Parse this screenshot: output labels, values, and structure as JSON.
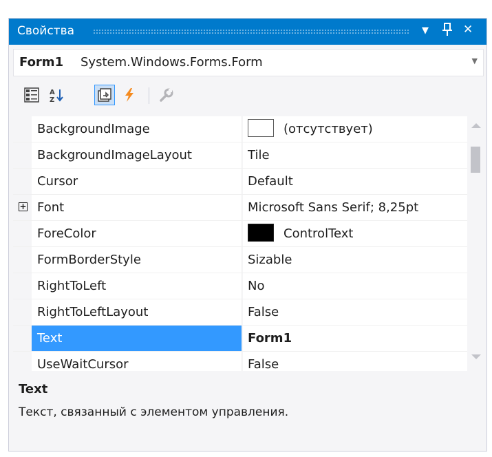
{
  "window": {
    "title": "Свойства",
    "controls": {
      "dropdown": "▼",
      "pin": "ᵖ",
      "close": "✕"
    }
  },
  "object_selector": {
    "name": "Form1",
    "type": "System.Windows.Forms.Form"
  },
  "toolbar": {
    "buttons": [
      {
        "icon": "categorized-icon",
        "active": false
      },
      {
        "icon": "alphabetical-icon",
        "active": false
      },
      {
        "icon": "properties-icon",
        "active": true
      },
      {
        "icon": "events-lightning-icon",
        "active": false
      },
      {
        "icon": "property-pages-wrench-icon",
        "active": false
      }
    ]
  },
  "properties": [
    {
      "name": "BackgroundImage",
      "value": "(отсутствует)",
      "swatch": "#ffffff"
    },
    {
      "name": "BackgroundImageLayout",
      "value": "Tile"
    },
    {
      "name": "Cursor",
      "value": "Default"
    },
    {
      "name": "Font",
      "value": "Microsoft Sans Serif; 8,25pt",
      "expander": "+"
    },
    {
      "name": "ForeColor",
      "value": "ControlText",
      "swatch": "#000000"
    },
    {
      "name": "FormBorderStyle",
      "value": "Sizable"
    },
    {
      "name": "RightToLeft",
      "value": "No"
    },
    {
      "name": "RightToLeftLayout",
      "value": "False"
    },
    {
      "name": "Text",
      "value": "Form1",
      "selected": true
    },
    {
      "name": "UseWaitCursor",
      "value": "False"
    }
  ],
  "description": {
    "title": "Text",
    "text": "Текст, связанный с элементом управления."
  },
  "colors": {
    "titlebar": "#007acc",
    "selection": "#3399ff",
    "lightning": "#f58b1f"
  }
}
